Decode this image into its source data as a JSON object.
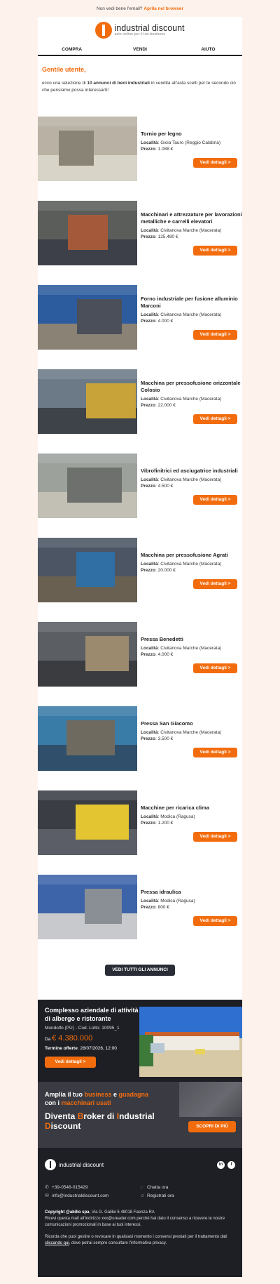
{
  "topbar": {
    "text": "Non vedi bene l'email?",
    "link": "Aprila nel browser"
  },
  "brand": {
    "name": "industrial discount",
    "tagline": "aste online per il tuo business"
  },
  "nav": [
    "COMPRA",
    "VENDI",
    "AIUTO"
  ],
  "intro": {
    "greeting": "Gentile utente,",
    "text_before": "ecco una selezione di ",
    "text_bold": "10 annunci di beni industriali",
    "text_after": " in vendita all'asta scelti per te secondo ciò che pensiamo possa interessarti!"
  },
  "labels": {
    "location": "Località",
    "price": "Prezzo",
    "details": "Vedi dettagli >"
  },
  "ads": [
    {
      "title": "Tornio per legno",
      "location": "Gioia Tauro (Reggio Calabria)",
      "price": "1.088 €",
      "colors": [
        "#b9b2a4",
        "#8a8476",
        "#d9d4c8"
      ]
    },
    {
      "title": "Macchinari e attrezzature per lavorazioni metalliche e carrelli elevatori",
      "location": "Civitanova Marche (Macerata)",
      "price": "125.480 €",
      "colors": [
        "#5a5d5a",
        "#a45a3a",
        "#3d4048"
      ]
    },
    {
      "title": "Forno industriale per fusione alluminio Marconi",
      "location": "Civitanova Marche (Macerata)",
      "price": "4.000 €",
      "colors": [
        "#2c5c9e",
        "#4a4f5a",
        "#8a8275"
      ]
    },
    {
      "title": "Macchina per pressofusione orizzontale Colosio",
      "location": "Civitanova Marche (Macerata)",
      "price": "22.000 €",
      "colors": [
        "#6c7a88",
        "#c8a33a",
        "#3e4249"
      ]
    },
    {
      "title": "Vibrofinitrici ed asciugatrice industriali",
      "location": "Civitanova Marche (Macerata)",
      "price": "4.500 €",
      "colors": [
        "#9da19c",
        "#6d706c",
        "#c2bfb4"
      ]
    },
    {
      "title": "Macchina per pressofusione Agrati",
      "location": "Civitanova Marche (Macerata)",
      "price": "20.000 €",
      "colors": [
        "#4b5563",
        "#2f6fa4",
        "#6a6052"
      ]
    },
    {
      "title": "Pressa Benedetti",
      "location": "Civitanova Marche (Macerata)",
      "price": "4.000 €",
      "colors": [
        "#5b5e63",
        "#9b8a6e",
        "#3a3c40"
      ]
    },
    {
      "title": "Pressa San Giacomo",
      "location": "Civitanova Marche (Macerata)",
      "price": "3.500 €",
      "colors": [
        "#3a7ca8",
        "#6f6a60",
        "#2f4f6a"
      ]
    },
    {
      "title": "Macchine per ricarica clima",
      "location": "Modica (Ragusa)",
      "price": "1.200 €",
      "colors": [
        "#3a3d44",
        "#e2c531",
        "#5b5e66"
      ]
    },
    {
      "title": "Pressa idraulica",
      "location": "Modica (Ragusa)",
      "price": "800 €",
      "colors": [
        "#3d63a8",
        "#8a8f95",
        "#c7c9cc"
      ]
    }
  ],
  "all_ads_button": "VEDI TUTTI GLI ANNUNCI",
  "featured": {
    "title": "Complesso aziendale di attività di albergo e ristorante",
    "location": "Mondolfo (PU) - Cod. Lotto: 10095_1",
    "price_prefix": "Da",
    "price": "€ 4.380.000",
    "deadline_label": "Termine offerte",
    "deadline": ": 28/07/2026, 12:00",
    "button": "Vedi dettagli >"
  },
  "promo": {
    "l1a": "Amplia il tuo ",
    "l1b": "business",
    "l1c": " e ",
    "l1d": "guadagna",
    "l1e": "con i ",
    "l1f": "macchinari usati",
    "l2a": "Diventa ",
    "l2b": "B",
    "l2c": "roker di ",
    "l2d": "I",
    "l2e": "ndustrial ",
    "l2f": "D",
    "l2g": "iscount",
    "button": "SCOPRI DI PIÙ"
  },
  "footer": {
    "brand": "industrial discount",
    "social": [
      "in",
      "f"
    ],
    "phone": "+39-0546-015429",
    "email": "info@industrialdiscount.com",
    "chat": "Chatta ora",
    "register": "Registrati ora",
    "copyright": "Copyright @abilio spa",
    "address": ", Via G. Galilei 6 48018 Faenza RA",
    "notice": "Ricevi questa mail all'indirizzo xxx@ureader.com perché hai dato il consenso a ricevere le nostre comunicazioni promozionali in base ai tuoi interessi.",
    "manage_before": "Ricorda che puoi gestire o revocare in qualsiasi momento i consensi prestati per il trattamento dati ",
    "manage_link": "cliccando qui",
    "manage_after": ", dove potrai sempre consultare l'informativa privacy."
  }
}
